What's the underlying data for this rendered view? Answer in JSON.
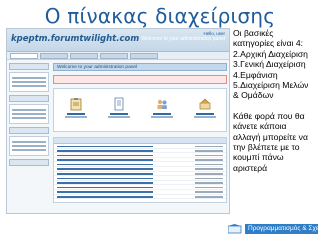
{
  "slide": {
    "title": "Ο πίνακας διαχείρισης"
  },
  "screenshot": {
    "logo_text": "kpeptm.forumtwilight.com",
    "user_line1": "Hello, user",
    "user_line2": "Welcome to your administration panel",
    "welcome_bar": "Welcome to your administration panel"
  },
  "side_text": {
    "lines": [
      "Οι βασικές",
      "κατηγορίες είναι 4:",
      "2.Αρχική Διαχείριση",
      "3.Γενική Διαχείριση",
      "4.Εμφάνιση",
      "5.Διαχείριση Μελών",
      "& Ομάδων"
    ],
    "para2": [
      "Κάθε φορά που θα",
      "κάνετε κάποια",
      "αλλαγή μπορείτε να",
      "την βλέπετε με το",
      "κουμπί πάνω",
      "αριστερά"
    ]
  },
  "footer": {
    "label": "Προγραμματισμός & Σχεδιασμός"
  },
  "colors": {
    "title": "#1f5c9a",
    "accent": "#2f7fc8"
  }
}
